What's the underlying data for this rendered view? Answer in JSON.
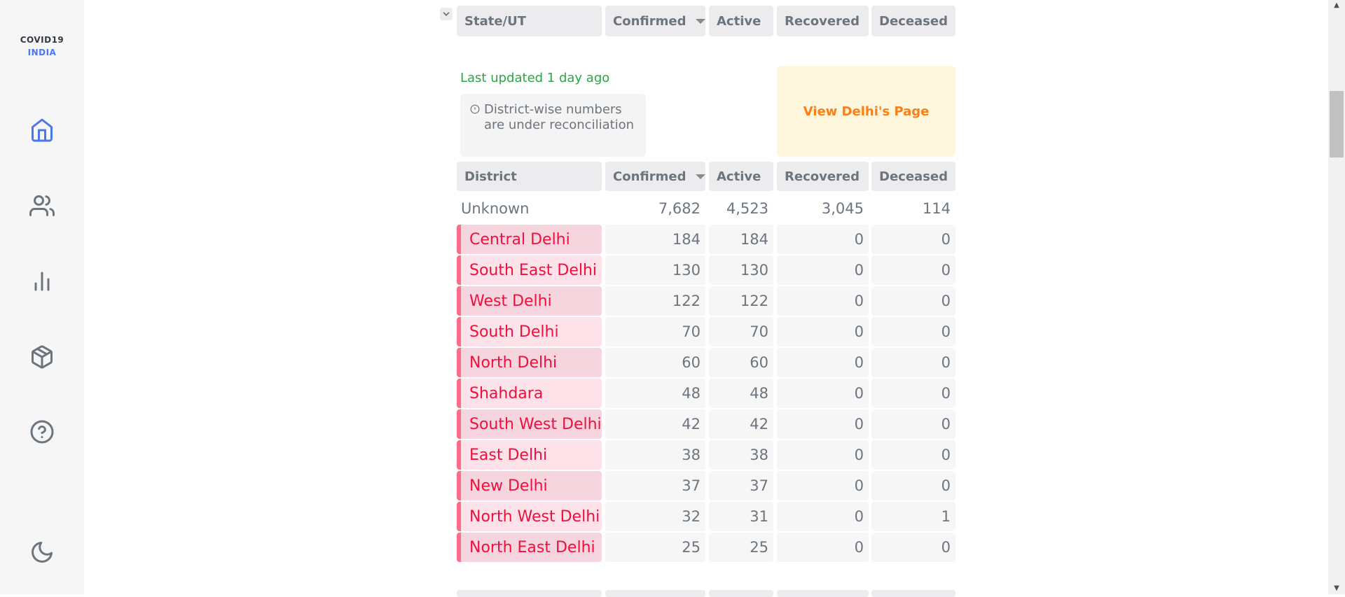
{
  "brand": {
    "line1": "COVID19",
    "line2": "INDIA"
  },
  "nav": [
    {
      "name": "home-icon",
      "color": "#4c75f2"
    },
    {
      "name": "users-icon",
      "color": "#6c757d"
    },
    {
      "name": "bar-chart-icon",
      "color": "#6c757d"
    },
    {
      "name": "package-icon",
      "color": "#6c757d"
    },
    {
      "name": "help-circle-icon",
      "color": "#6c757d"
    },
    {
      "name": "moon-icon",
      "color": "#6c757d"
    }
  ],
  "state_table": {
    "headers": [
      "State/UT",
      "Confirmed",
      "Active",
      "Recovered",
      "Deceased"
    ]
  },
  "state_detail": {
    "last_updated": "Last updated 1 day ago",
    "notice": "District-wise numbers are under reconciliation",
    "view_page_label": "View Delhi's Page"
  },
  "district_table": {
    "headers": [
      "District",
      "Confirmed",
      "Active",
      "Recovered",
      "Deceased"
    ],
    "rows": [
      {
        "district": "Unknown",
        "confirmed": "7,682",
        "active": "4,523",
        "recovered": "3,045",
        "deceased": "114"
      },
      {
        "district": "Central Delhi",
        "confirmed": "184",
        "active": "184",
        "recovered": "0",
        "deceased": "0"
      },
      {
        "district": "South East Delhi",
        "confirmed": "130",
        "active": "130",
        "recovered": "0",
        "deceased": "0"
      },
      {
        "district": "West Delhi",
        "confirmed": "122",
        "active": "122",
        "recovered": "0",
        "deceased": "0"
      },
      {
        "district": "South Delhi",
        "confirmed": "70",
        "active": "70",
        "recovered": "0",
        "deceased": "0"
      },
      {
        "district": "North Delhi",
        "confirmed": "60",
        "active": "60",
        "recovered": "0",
        "deceased": "0"
      },
      {
        "district": "Shahdara",
        "confirmed": "48",
        "active": "48",
        "recovered": "0",
        "deceased": "0"
      },
      {
        "district": "South West Delhi",
        "confirmed": "42",
        "active": "42",
        "recovered": "0",
        "deceased": "0"
      },
      {
        "district": "East Delhi",
        "confirmed": "38",
        "active": "38",
        "recovered": "0",
        "deceased": "0"
      },
      {
        "district": "New Delhi",
        "confirmed": "37",
        "active": "37",
        "recovered": "0",
        "deceased": "0"
      },
      {
        "district": "North West Delhi",
        "confirmed": "32",
        "active": "31",
        "recovered": "0",
        "deceased": "1"
      },
      {
        "district": "North East Delhi",
        "confirmed": "25",
        "active": "25",
        "recovered": "0",
        "deceased": "0"
      }
    ]
  },
  "colors": {
    "accent_blue": "#4c75f2",
    "district_red": "#ef0f3e",
    "updated_green": "#28a745",
    "view_page_orange": "#fd7e14"
  }
}
